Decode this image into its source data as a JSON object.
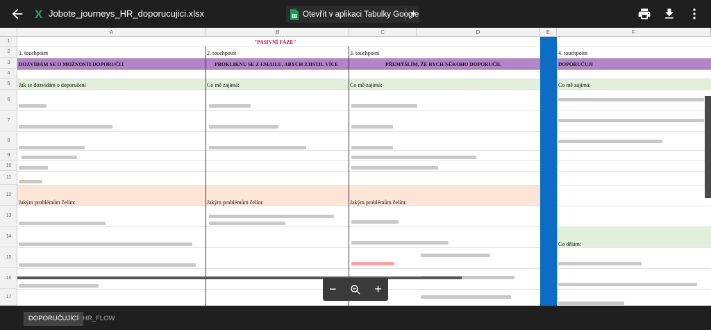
{
  "header": {
    "filename": "Jobote_journeys_HR_doporucujici.xlsx",
    "open_button_label": "Otevřít v aplikaci Tabulky Google",
    "icons": [
      "back-arrow-icon",
      "excel-icon",
      "print-icon",
      "download-icon",
      "more-vert-icon"
    ]
  },
  "sheet": {
    "columns": [
      "A",
      "B",
      "C",
      "D",
      "E",
      "F"
    ],
    "rows": [
      "1",
      "2",
      "3",
      "4",
      "5",
      "6",
      "7",
      "8",
      "9",
      "10",
      "11",
      "12",
      "13",
      "14",
      "15",
      "16",
      "17"
    ],
    "title": "\"PASIVNÍ FÁZE\"",
    "touchpoints": [
      "1. touchpoint",
      "2. touchpoint",
      "3. touchpoint",
      "4. touchpoint"
    ],
    "headings": [
      "DOZVÍDÁM SE O MOŽNOSTI DOPORUČIT",
      "PROKLIKNU SE Z EMAILU, ABYCH ZJISTIL VÍCE",
      "PŘEMÝŠLÍM, ŽE BYCH NĚKOHO  DOPORUČIL",
      "DOPORUČUJI"
    ],
    "q_find_out": "Jak se dozvídám o doporučení",
    "q_interest": "Co mě zajímá:",
    "q_problem": "Jakým problémům čelím:",
    "q_do": "Co dělám:",
    "colors": {
      "heading_purple": "#b384c8",
      "green": "#e2efda",
      "salmon": "#fce4d6",
      "blue": "#0d6dc4",
      "title_red": "#c0004a"
    }
  },
  "zoom": {
    "minus": "−",
    "zoom_icon": "zoom-out-icon",
    "plus": "+"
  },
  "tabs": {
    "active": "DOPORUČUJÍCÍ",
    "inactive": "HR_FLOW"
  }
}
